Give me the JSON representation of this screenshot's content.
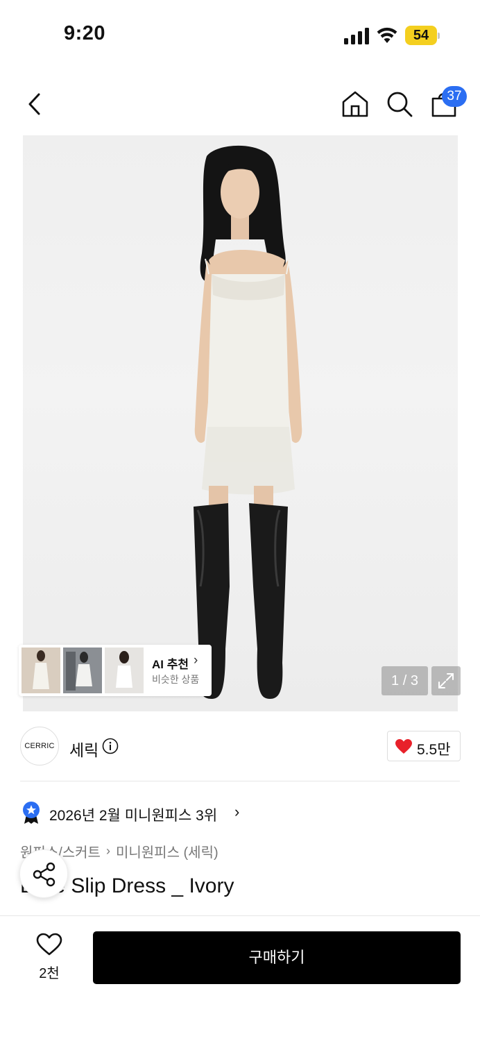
{
  "status_bar": {
    "time": "9:20",
    "battery": "54",
    "battery_color": "#f4cf1f",
    "icons": [
      "cellular-signal-icon",
      "wifi-icon",
      "battery-icon"
    ]
  },
  "nav": {
    "icons": [
      "back-arrow-icon",
      "home-icon",
      "search-icon",
      "shopping-bag-icon"
    ],
    "cart_count": "37",
    "badge_color": "#2b6ef2"
  },
  "gallery": {
    "ai_recommend_title": "AI 추천",
    "ai_recommend_sub": "비슷한 상품",
    "page_indicator": "1 / 3",
    "expand_icon": "expand-arrows-icon"
  },
  "brand": {
    "logo_text": "CERRIC",
    "name": "세릭",
    "likes": "5.5만",
    "like_color": "#e8212a"
  },
  "ranking": {
    "text": "2026년 2월 미니원피스 3위",
    "chevron": "›"
  },
  "breadcrumb": {
    "level1": "원피스/스커트",
    "level2": "미니원피스 (세릭)",
    "separator": "›"
  },
  "product": {
    "title": "Lace Slip Dress _ Ivory"
  },
  "bottom_bar": {
    "wish_count": "2천",
    "buy_label": "구매하기"
  }
}
